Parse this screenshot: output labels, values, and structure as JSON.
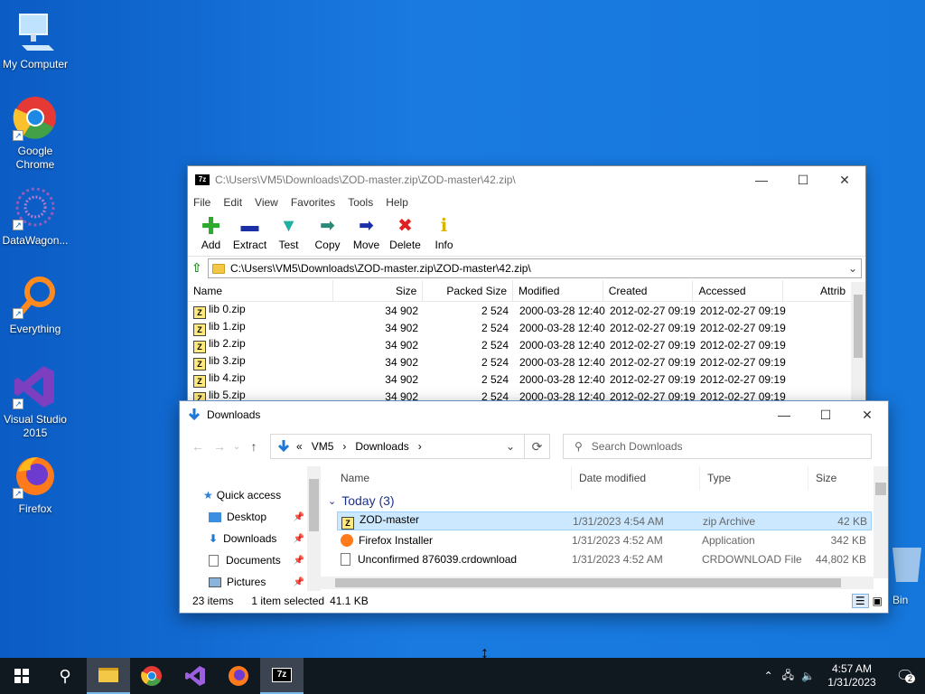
{
  "desktop": {
    "icons": [
      {
        "label": "My Computer",
        "icon": "computer-icon"
      },
      {
        "label": "Google Chrome",
        "icon": "chrome-icon"
      },
      {
        "label": "DataWagon...",
        "icon": "datawagon-icon"
      },
      {
        "label": "Everything",
        "icon": "everything-search-icon"
      },
      {
        "label": "Visual Studio 2015",
        "icon": "visual-studio-icon"
      },
      {
        "label": "Firefox",
        "icon": "firefox-icon"
      }
    ],
    "recycle_label": "Bin"
  },
  "sevenzip": {
    "title": "C:\\Users\\VM5\\Downloads\\ZOD-master.zip\\ZOD-master\\42.zip\\",
    "menu": [
      "File",
      "Edit",
      "View",
      "Favorites",
      "Tools",
      "Help"
    ],
    "toolbar": [
      {
        "label": "Add",
        "icon": "add-icon",
        "color": "#2eaa2e"
      },
      {
        "label": "Extract",
        "icon": "extract-icon",
        "color": "#1b2fa6"
      },
      {
        "label": "Test",
        "icon": "test-icon",
        "color": "#1fb0a0"
      },
      {
        "label": "Copy",
        "icon": "copy-icon",
        "color": "#2a8a78"
      },
      {
        "label": "Move",
        "icon": "move-icon",
        "color": "#1b2fa6"
      },
      {
        "label": "Delete",
        "icon": "delete-icon",
        "color": "#e02020"
      },
      {
        "label": "Info",
        "icon": "info-icon",
        "color": "#d8b400"
      }
    ],
    "address": "C:\\Users\\VM5\\Downloads\\ZOD-master.zip\\ZOD-master\\42.zip\\",
    "columns": [
      "Name",
      "Size",
      "Packed Size",
      "Modified",
      "Created",
      "Accessed",
      "Attrib"
    ],
    "rows": [
      [
        "lib 0.zip",
        "34 902",
        "2 524",
        "2000-03-28 12:40",
        "2012-02-27 09:19",
        "2012-02-27 09:19"
      ],
      [
        "lib 1.zip",
        "34 902",
        "2 524",
        "2000-03-28 12:40",
        "2012-02-27 09:19",
        "2012-02-27 09:19"
      ],
      [
        "lib 2.zip",
        "34 902",
        "2 524",
        "2000-03-28 12:40",
        "2012-02-27 09:19",
        "2012-02-27 09:19"
      ],
      [
        "lib 3.zip",
        "34 902",
        "2 524",
        "2000-03-28 12:40",
        "2012-02-27 09:19",
        "2012-02-27 09:19"
      ],
      [
        "lib 4.zip",
        "34 902",
        "2 524",
        "2000-03-28 12:40",
        "2012-02-27 09:19",
        "2012-02-27 09:19"
      ],
      [
        "lib 5.zip",
        "34 902",
        "2 524",
        "2000-03-28 12:40",
        "2012-02-27 09:19",
        "2012-02-27 09:19"
      ]
    ]
  },
  "explorer": {
    "title": "Downloads",
    "breadcrumb": [
      "«",
      "VM5",
      "›",
      "Downloads",
      "›"
    ],
    "search_placeholder": "Search Downloads",
    "nav": [
      {
        "label": "Quick access",
        "icon": "star-icon",
        "pinned": false
      },
      {
        "label": "Desktop",
        "icon": "desktop-icon",
        "pinned": true
      },
      {
        "label": "Downloads",
        "icon": "download-icon",
        "pinned": true
      },
      {
        "label": "Documents",
        "icon": "documents-icon",
        "pinned": true
      },
      {
        "label": "Pictures",
        "icon": "pictures-icon",
        "pinned": true
      }
    ],
    "columns": [
      "Name",
      "Date modified",
      "Type",
      "Size"
    ],
    "group": "Today (3)",
    "files": [
      {
        "name": "ZOD-master",
        "date": "1/31/2023 4:54 AM",
        "type": "zip Archive",
        "size": "42 KB",
        "selected": true
      },
      {
        "name": "Firefox Installer",
        "date": "1/31/2023 4:52 AM",
        "type": "Application",
        "size": "342 KB",
        "selected": false
      },
      {
        "name": "Unconfirmed 876039.crdownload",
        "date": "1/31/2023 4:52 AM",
        "type": "CRDOWNLOAD File",
        "size": "44,802 KB",
        "selected": false
      }
    ],
    "status": {
      "items": "23 items",
      "selected": "1 item selected",
      "size": "41.1 KB"
    }
  },
  "taskbar": {
    "time": "4:57 AM",
    "date": "1/31/2023",
    "notif_count": "2"
  }
}
